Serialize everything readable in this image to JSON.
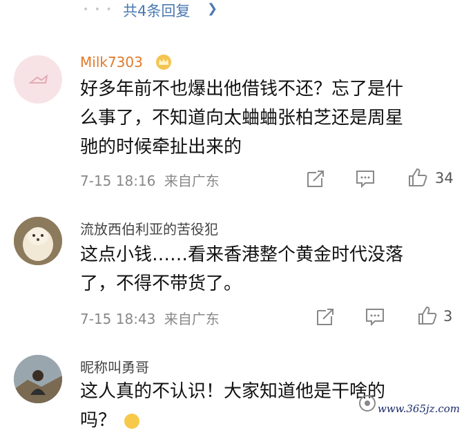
{
  "top": {
    "more_replies": "共4条回复"
  },
  "comments": [
    {
      "username": "Milk7303",
      "text_lines": [
        "好多年前不也爆出他借钱不还？忘了是什",
        "么事了，不知道向太蛐蛐张柏芝还是周星",
        "驰的时候牵扯出来的"
      ],
      "time": "7-15 18:16",
      "source": "来自广东",
      "likes": "34"
    },
    {
      "username": "流放西伯利亚的苦役犯",
      "text_lines": [
        "这点小钱……看来香港整个黄金时代没落",
        "了，不得不带货了。"
      ],
      "time": "7-15 18:43",
      "source": "来自广东",
      "likes": "3"
    },
    {
      "username": "昵称叫勇哥",
      "text_lines": [
        "这人真的不认识！大家知道他是干啥的",
        "吗？"
      ],
      "time": "",
      "source": "",
      "likes": ""
    }
  ],
  "watermark": "www.365jz.com"
}
